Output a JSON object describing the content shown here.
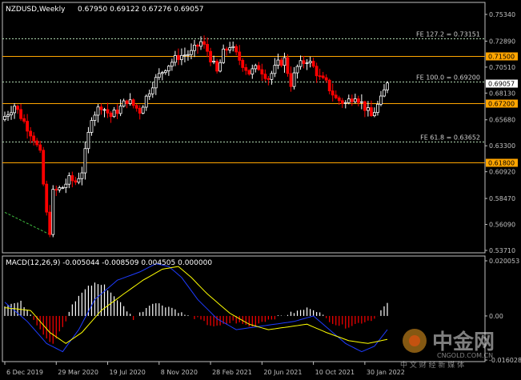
{
  "header": {
    "symbol": "NZDUSD,Weekly",
    "ohlc": "0.67950 0.69122 0.67276 0.69057",
    "indicator": "MACD(12,26,9) -0.005044 -0.008509 0.004505 0.000000"
  },
  "watermark": {
    "brand_cn": "中金网",
    "brand_en": "CNGOLD.COM.CN",
    "tagline": "中 文 财 经 新 媒 体"
  },
  "colors": {
    "background": "#000000",
    "bull": "#FFFFFF",
    "bear": "#FF0000",
    "axis": "#C0C0C0",
    "fib_line": "#B0D8B0",
    "sr_line": "#FFA500",
    "macd_signal": "#FFFF00",
    "macd_main": "#1E3CFF",
    "trend_line": "#40C040",
    "current_price_tag": "#FFFFFF",
    "level_tag": "#FFA500"
  },
  "chart_data": [
    {
      "type": "candlestick",
      "title": "NZDUSD,Weekly",
      "xlabel": "",
      "ylabel": "",
      "ylim": [
        0.5371,
        0.7534
      ],
      "y_ticks": [
        "0.75340",
        "0.72890",
        "0.70510",
        "0.68130",
        "0.65680",
        "0.63300",
        "0.60920",
        "0.58470",
        "0.56090",
        "0.53710"
      ],
      "x_ticks": [
        "6 Dec 2019",
        "29 Mar 2020",
        "19 Jul 2020",
        "8 Nov 2020",
        "28 Feb 2021",
        "20 Jun 2021",
        "10 Oct 2021",
        "30 Jan 2022"
      ],
      "x_tick_index": [
        0,
        16,
        32,
        48,
        64,
        80,
        96,
        112
      ],
      "candle_count": 120,
      "levels": [
        {
          "label": "FE 127.2 = 0.73151",
          "value": 0.73151,
          "kind": "fib"
        },
        {
          "label": "FE 100.0 = 0.69200",
          "value": 0.692,
          "kind": "fib"
        },
        {
          "label": "FE 61.8 = 0.63652",
          "value": 0.63652,
          "kind": "fib"
        },
        {
          "label": "",
          "value": 0.715,
          "kind": "sr",
          "tag": "0.71500"
        },
        {
          "label": "",
          "value": 0.672,
          "kind": "sr",
          "tag": "0.67200"
        },
        {
          "label": "",
          "value": 0.618,
          "kind": "sr",
          "tag": "0.61800"
        }
      ],
      "current_price": {
        "value": 0.69057,
        "tag": "0.69057"
      },
      "close_path": [
        [
          0,
          0.66
        ],
        [
          3,
          0.67
        ],
        [
          6,
          0.655
        ],
        [
          9,
          0.64
        ],
        [
          11,
          0.625
        ],
        [
          13,
          0.57
        ],
        [
          14,
          0.555
        ],
        [
          15,
          0.59
        ],
        [
          18,
          0.595
        ],
        [
          20,
          0.602
        ],
        [
          22,
          0.6
        ],
        [
          24,
          0.61
        ],
        [
          27,
          0.66
        ],
        [
          30,
          0.67
        ],
        [
          33,
          0.66
        ],
        [
          36,
          0.668
        ],
        [
          38,
          0.675
        ],
        [
          42,
          0.665
        ],
        [
          46,
          0.69
        ],
        [
          50,
          0.705
        ],
        [
          54,
          0.715
        ],
        [
          58,
          0.718
        ],
        [
          61,
          0.728
        ],
        [
          63,
          0.72
        ],
        [
          66,
          0.7
        ],
        [
          68,
          0.718
        ],
        [
          70,
          0.725
        ],
        [
          73,
          0.712
        ],
        [
          76,
          0.7
        ],
        [
          79,
          0.705
        ],
        [
          82,
          0.695
        ],
        [
          85,
          0.708
        ],
        [
          87,
          0.712
        ],
        [
          89,
          0.69
        ],
        [
          91,
          0.705
        ],
        [
          94,
          0.712
        ],
        [
          96,
          0.705
        ],
        [
          98,
          0.695
        ],
        [
          100,
          0.69
        ],
        [
          103,
          0.676
        ],
        [
          106,
          0.672
        ],
        [
          109,
          0.68
        ],
        [
          112,
          0.668
        ],
        [
          114,
          0.66
        ],
        [
          117,
          0.675
        ],
        [
          119,
          0.6906
        ]
      ],
      "trend_segment": {
        "from": [
          0,
          0.572
        ],
        "to": [
          14,
          0.5517
        ]
      }
    },
    {
      "type": "bar",
      "title": "MACD(12,26,9)",
      "values_shown": {
        "main": -0.005044,
        "signal": -0.008509,
        "histogram": 0.004505,
        "extra": 0.0
      },
      "ylim": [
        -0.01602,
        0.020053
      ],
      "y_ticks": [
        "0.020053",
        "0.00",
        "-0.016028"
      ],
      "histogram_path": [
        [
          0,
          0.004
        ],
        [
          5,
          0.005
        ],
        [
          8,
          0.001
        ],
        [
          10,
          -0.003
        ],
        [
          13,
          -0.008
        ],
        [
          15,
          -0.01
        ],
        [
          17,
          -0.006
        ],
        [
          19,
          -0.002
        ],
        [
          21,
          0.004
        ],
        [
          25,
          0.01
        ],
        [
          28,
          0.012
        ],
        [
          31,
          0.011
        ],
        [
          35,
          0.006
        ],
        [
          38,
          0.002
        ],
        [
          40,
          -0.001
        ],
        [
          43,
          0.002
        ],
        [
          46,
          0.005
        ],
        [
          49,
          0.004
        ],
        [
          52,
          0.003
        ],
        [
          55,
          0.001
        ],
        [
          57,
          0.0
        ],
        [
          60,
          -0.001
        ],
        [
          63,
          -0.003
        ],
        [
          66,
          -0.004
        ],
        [
          69,
          -0.003
        ],
        [
          71,
          -0.002
        ],
        [
          74,
          -0.003
        ],
        [
          77,
          -0.004
        ],
        [
          80,
          -0.002
        ],
        [
          83,
          -0.001
        ],
        [
          86,
          0.0
        ],
        [
          89,
          0.001
        ],
        [
          92,
          0.002
        ],
        [
          95,
          0.003
        ],
        [
          97,
          0.002
        ],
        [
          100,
          -0.001
        ],
        [
          103,
          -0.003
        ],
        [
          106,
          -0.004
        ],
        [
          109,
          -0.003
        ],
        [
          112,
          -0.002
        ],
        [
          115,
          -0.001
        ],
        [
          117,
          0.002
        ],
        [
          119,
          0.0045
        ]
      ],
      "signal_path": [
        [
          0,
          0.003
        ],
        [
          8,
          0.002
        ],
        [
          14,
          -0.006
        ],
        [
          19,
          -0.01
        ],
        [
          24,
          -0.006
        ],
        [
          30,
          0.002
        ],
        [
          37,
          0.008
        ],
        [
          43,
          0.013
        ],
        [
          49,
          0.017
        ],
        [
          54,
          0.018
        ],
        [
          58,
          0.014
        ],
        [
          63,
          0.008
        ],
        [
          70,
          0.001
        ],
        [
          76,
          -0.003
        ],
        [
          82,
          -0.005
        ],
        [
          88,
          -0.004
        ],
        [
          94,
          -0.003
        ],
        [
          100,
          -0.006
        ],
        [
          107,
          -0.009
        ],
        [
          113,
          -0.01
        ],
        [
          119,
          -0.0085
        ]
      ],
      "main_path": [
        [
          0,
          0.005
        ],
        [
          7,
          -0.002
        ],
        [
          13,
          -0.01
        ],
        [
          18,
          -0.013
        ],
        [
          23,
          -0.005
        ],
        [
          28,
          0.006
        ],
        [
          35,
          0.013
        ],
        [
          42,
          0.016
        ],
        [
          47,
          0.019
        ],
        [
          51,
          0.018
        ],
        [
          55,
          0.014
        ],
        [
          60,
          0.006
        ],
        [
          66,
          -0.001
        ],
        [
          72,
          -0.005
        ],
        [
          78,
          -0.004
        ],
        [
          84,
          -0.003
        ],
        [
          90,
          -0.002
        ],
        [
          96,
          0.0
        ],
        [
          100,
          -0.004
        ],
        [
          106,
          -0.01
        ],
        [
          111,
          -0.013
        ],
        [
          115,
          -0.011
        ],
        [
          119,
          -0.005
        ]
      ]
    }
  ]
}
